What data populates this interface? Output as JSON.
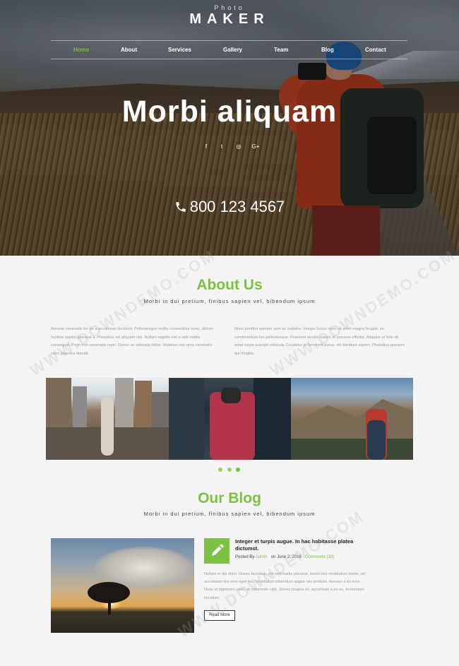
{
  "logo": {
    "small": "Photo",
    "big": "MAKER"
  },
  "nav": {
    "items": [
      {
        "label": "Home",
        "active": true
      },
      {
        "label": "About",
        "active": false
      },
      {
        "label": "Services",
        "active": false
      },
      {
        "label": "Gallery",
        "active": false
      },
      {
        "label": "Team",
        "active": false
      },
      {
        "label": "Blog",
        "active": false
      },
      {
        "label": "Contact",
        "active": false
      }
    ]
  },
  "hero": {
    "title": "Morbi aliquam",
    "social": [
      "f",
      "t",
      "◎",
      "G+"
    ],
    "phone": "800 123 4567"
  },
  "about": {
    "title": "About Us",
    "subtitle": "Morbi in dui pretium, finibus sapien vel, bibendum ipsum",
    "col_left": "Aenean venenatis tor tor a accumsan tincidunt. Pellentesque mollis consectetur nunc, dictum facilisis sapien placerat a. Phasellus vel aliquam nisi. Nullam sagittis nisi a velit mattis consequat. Proin non venenatis nunc. Donec ac vehicula tellus. Vivamus nec urna venenatis nunc pharetra blandit.",
    "col_right": "Nunc porttitor semper sem ac sodales. Integer luctus nunc sit amet magna feugiat, eu condimentum leo pellentesque. Praesent iaculis mauris at posuere efficitur. Aliquam at felis sit amet turpis suscipit vehicula. Curabitur id hendrerit purus, vel tincidunt sapien. Phasellus posuere dui fringilla."
  },
  "gallery": {
    "active_dot": 3,
    "dot_count": 3
  },
  "blog": {
    "title": "Our Blog",
    "subtitle": "Morbi in dui pretium, finibus sapien vel, bibendum ipsum",
    "post": {
      "title": "Integer et turpis augue. In hac habitasse platea dictumst.",
      "posted_by_label": "Posted By",
      "author": "Admin",
      "date": "on June 2, 2016",
      "comments": "Comments (10)",
      "body": "Nullam in dui dolor. Donec faucibus, est sed mattis placerat, lorem orci vestibulum lorem, vel accumsan nisi eros eget leo. Vestibulum bibendum augue nec pretium. Aenean a ex eros. Nunc id dignissim justo, at commodo nibh. Donec magna mi, accumsan a ex eu, fermentum tincidunt.",
      "read_more": "Read More"
    }
  },
  "watermark": "WWW.DOWNDEMO.COM",
  "colors": {
    "accent": "#7cc242",
    "background": "#f4f4f4",
    "text_muted": "#9b9b9b"
  }
}
